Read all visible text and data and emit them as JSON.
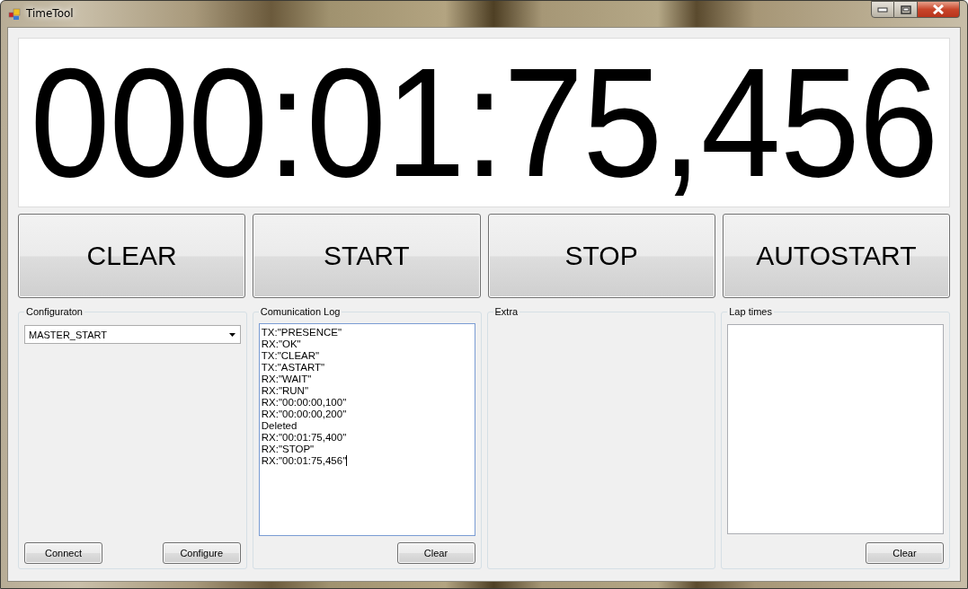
{
  "window": {
    "title": "TimeTool"
  },
  "display": {
    "value": "000:01:75,456"
  },
  "main_buttons": [
    "CLEAR",
    "START",
    "STOP",
    "AUTOSTART"
  ],
  "groups": [
    {
      "kind": "config",
      "title": "Configuraton",
      "dropdown": {
        "value": "MASTER_START"
      },
      "buttons": [
        "Connect",
        "Configure"
      ]
    },
    {
      "kind": "log",
      "title": "Comunication Log",
      "caret": true,
      "lines": [
        "TX:\"PRESENCE\"",
        "RX:\"OK\"",
        "TX:\"CLEAR\"",
        "TX:\"ASTART\"",
        "RX:\"WAIT\"",
        "RX:\"RUN\"",
        "RX:\"00:00:00,100\"",
        "RX:\"00:00:00,200\"",
        "Deleted",
        "RX:\"00:01:75,400\"",
        "RX:\"STOP\"",
        "RX:\"00:01:75,456\""
      ],
      "buttons": [
        "Clear"
      ]
    },
    {
      "kind": "empty",
      "title": "Extra"
    },
    {
      "kind": "list",
      "title": "Lap times",
      "buttons": [
        "Clear"
      ]
    }
  ]
}
